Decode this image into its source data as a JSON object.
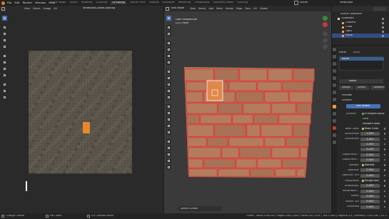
{
  "top_menu": [
    "File",
    "Edit",
    "Render",
    "Window",
    "Help"
  ],
  "workspaces": [
    "Shape Image",
    "Layout",
    "Modeling",
    "Sculpting",
    "UV Editing",
    "Texture Paint",
    "Shading",
    "Animation",
    "Rendering",
    "Compositing",
    "Geometry Nodes",
    "Scripting"
  ],
  "active_workspace": "UV Editing",
  "scene_label": "Scene",
  "viewlayer_label": "ViewLayer",
  "uv_editor": {
    "header_items": [
      "View",
      "Select",
      "Image",
      "UV"
    ],
    "image_name": "WheBoard_BaseColoursq"
  },
  "viewport": {
    "mode": "Edit Mode",
    "header_items": [
      "View",
      "Select",
      "Add",
      "Mesh",
      "Vertex",
      "Edge",
      "Face",
      "UV"
    ],
    "transform_orientation": "Global",
    "overlay_title": "User Perspective",
    "overlay_object": "(21) Plane",
    "operator_label": "Select Linked",
    "status_stats": "Plane | Verts:256/256 | Edges:256/2,560 | Faces:32/1,024 | Tris:2,048 | Objects:1/1 | Memory: 1.63 GiB | 3.4.1"
  },
  "status_bar": {
    "left_label": "Change Frame",
    "middle_label": "Pan View",
    "right_label": "UV Context Menu"
  },
  "outliner": {
    "title": "Scene Collection",
    "items": [
      {
        "label": "Collection"
      },
      {
        "label": "Camera"
      },
      {
        "label": "Cube"
      },
      {
        "label": "Light"
      },
      {
        "label": "Plane"
      }
    ]
  },
  "properties": {
    "object_name": "Plane",
    "object_tab": "Body",
    "material_slot": "Matte",
    "material_name": "Matte",
    "actions": [
      "Assign",
      "Select",
      "Deselect"
    ],
    "sections": [
      "Preview",
      "Surface"
    ],
    "use_nodes_label": "Use Nodes",
    "surface_label": "Surface",
    "surface_value": "Principled BSDF",
    "distribution": "GGX",
    "subsurface_method": "Random Walk",
    "rows": [
      {
        "label": "Base Color",
        "value": "Base Color"
      },
      {
        "label": "Subsurface",
        "value": "0.000"
      },
      {
        "label": "Subsurface",
        "value": "1.000"
      },
      {
        "label": "",
        "value": "0.200"
      },
      {
        "label": "",
        "value": "0.100"
      },
      {
        "label": "Subsurface...",
        "value": "0.000"
      },
      {
        "label": "Subsurface...",
        "value": "0.000"
      },
      {
        "label": "Metallic",
        "value": "Metallic"
      },
      {
        "label": "Specular",
        "value": "0.500"
      },
      {
        "label": "Specular Tint",
        "value": "0.000"
      },
      {
        "label": "Roughness",
        "value": "Roughness"
      },
      {
        "label": "Anisotropic",
        "value": "0.000"
      },
      {
        "label": "Anisotropic...",
        "value": "0.000"
      },
      {
        "label": "Sheen",
        "value": "0.000"
      },
      {
        "label": "Sheen Tint",
        "value": "0.500"
      },
      {
        "label": "Clearcoat",
        "value": "0.000"
      }
    ]
  },
  "colors": {
    "accent": "#4772b3",
    "selection_orange": "#f08a2a",
    "uv_edge_red": "#e03636",
    "plank_fill": "#b07858",
    "grid_bg": "#3a3a3a"
  }
}
